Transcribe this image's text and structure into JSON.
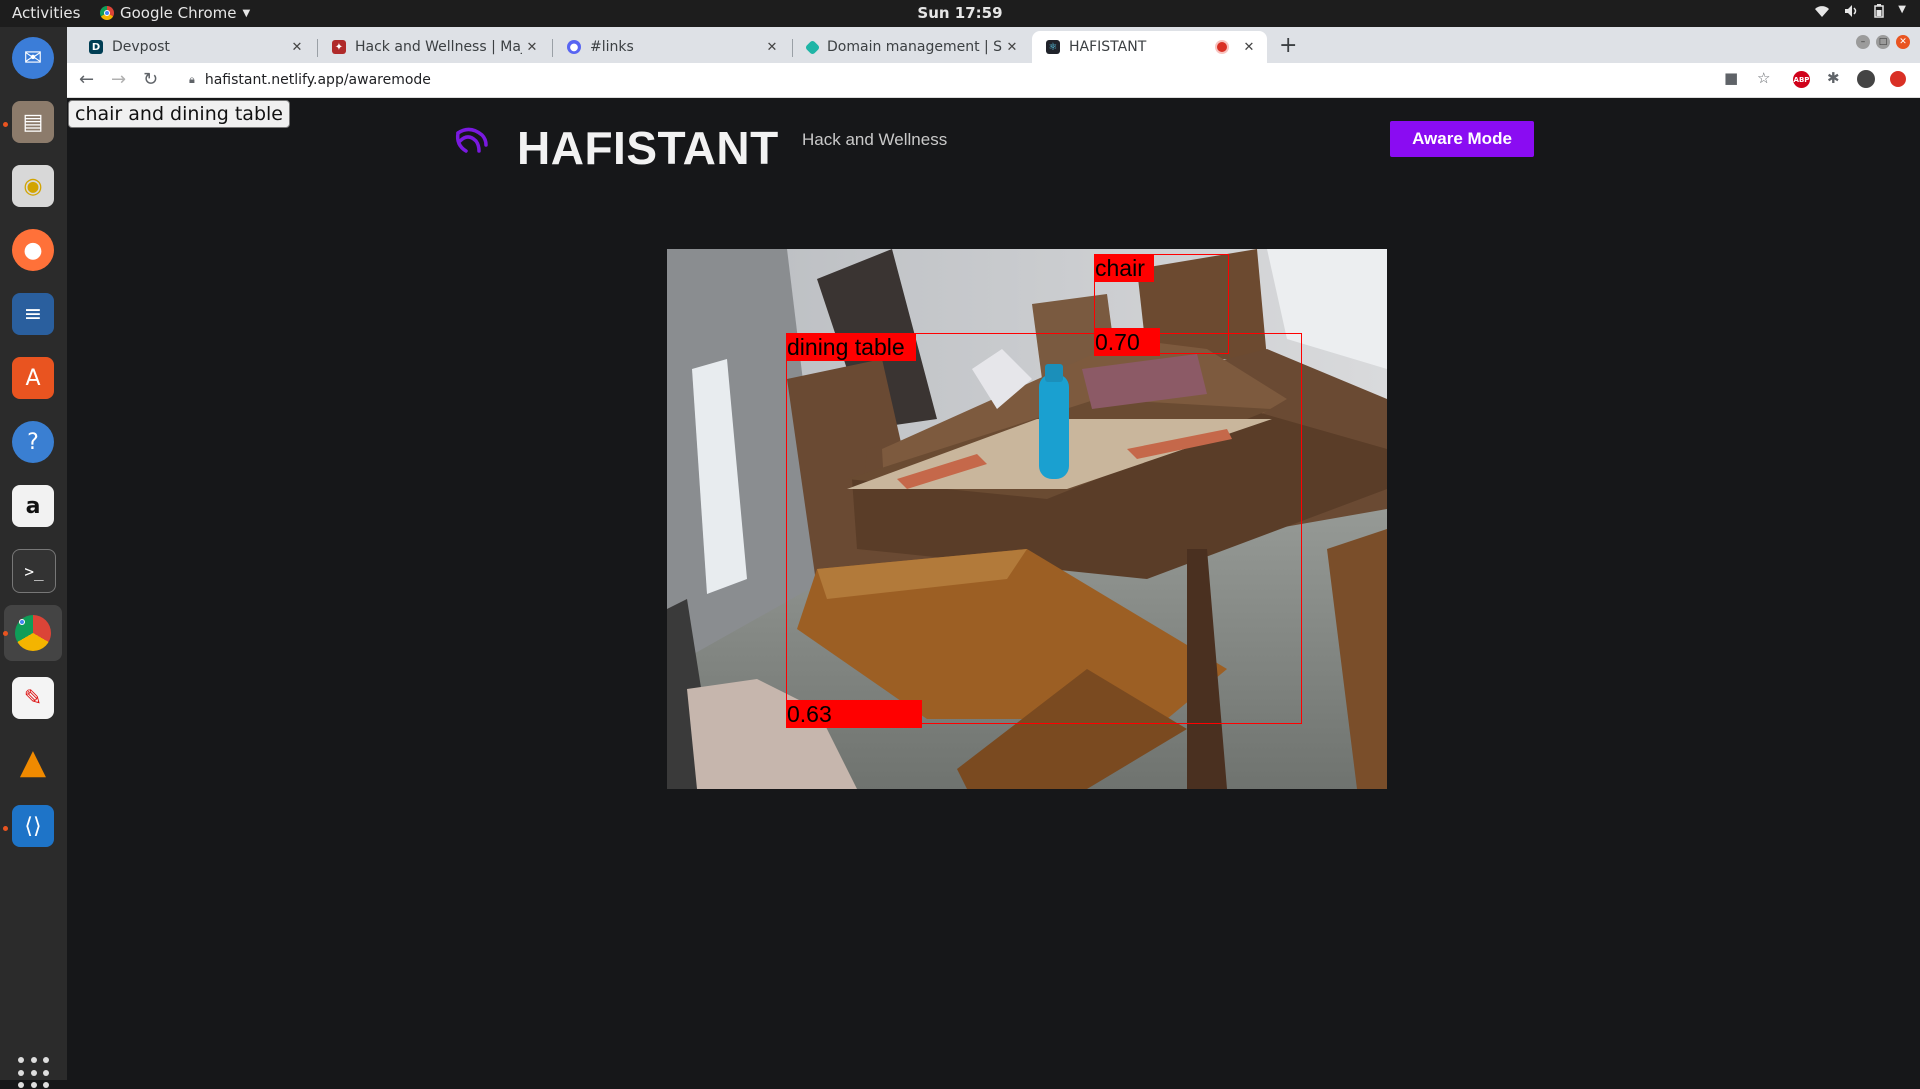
{
  "system": {
    "activities": "Activities",
    "app_name": "Google Chrome",
    "clock": "Sun 17:59"
  },
  "tabs": [
    {
      "title": "Devpost",
      "favicon": "devpost-icon",
      "active": false
    },
    {
      "title": "Hack and Wellness | Majo",
      "favicon": "majorleague-icon",
      "active": false
    },
    {
      "title": "#links",
      "favicon": "discord-icon",
      "active": false
    },
    {
      "title": "Domain management | Si",
      "favicon": "netlify-icon",
      "active": false
    },
    {
      "title": "HAFISTANT",
      "favicon": "react-icon",
      "active": true
    }
  ],
  "address": {
    "url": "hafistant.netlify.app/awaremode"
  },
  "page": {
    "tooltip": "chair and dining table",
    "brand": "HAFISTANT",
    "tagline": "Hack and Wellness",
    "aware_button": "Aware Mode",
    "accent_color": "#8a0cf2"
  },
  "detections": [
    {
      "class": "chair",
      "score": "0.70"
    },
    {
      "class": "dining table",
      "score": "0.63"
    }
  ],
  "colors": {
    "page_bg": "#161719",
    "detection": "#ff0000"
  }
}
